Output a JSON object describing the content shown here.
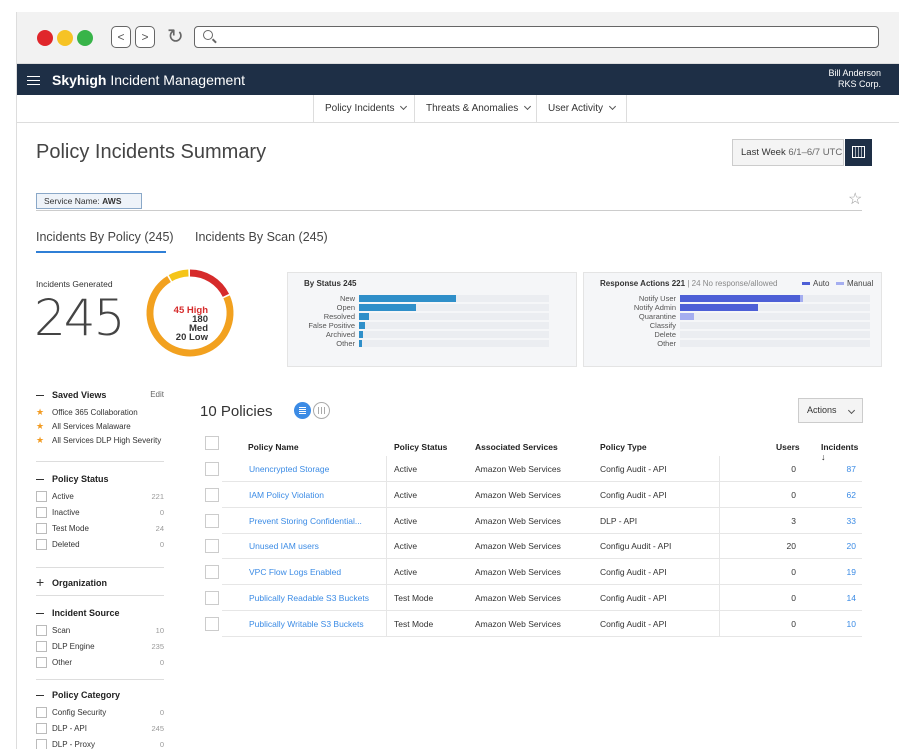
{
  "app": {
    "brand_bold": "Skyhigh",
    "brand_rest": "Incident Management",
    "user_name": "Bill Anderson",
    "user_org": "RKS Corp."
  },
  "browser": {
    "back_label": "<",
    "forward_label": ">",
    "reload_label": "↻",
    "traffic_lights": [
      "#e0262b",
      "#f6c325",
      "#38b449"
    ]
  },
  "topnav": {
    "items": [
      {
        "label": "Policy Incidents"
      },
      {
        "label": "Threats & Anomalies"
      },
      {
        "label": "User Activity"
      }
    ]
  },
  "page": {
    "title": "Policy Incidents Summary",
    "date_label": "Last Week",
    "date_range": "6/1–6/7 UTC",
    "filter_prefix": "Service Name:",
    "filter_value": "AWS",
    "tabs": [
      {
        "label": "Incidents By Policy (245)",
        "active": true
      },
      {
        "label": "Incidents By Scan (245)",
        "active": false
      }
    ]
  },
  "summary": {
    "generated_label": "Incidents Generated",
    "generated_value": "245",
    "severity": [
      {
        "count": "45",
        "label": "High",
        "color": "#d62b2b",
        "value": 45
      },
      {
        "count": "180",
        "label": "Med",
        "color": "#f2a11f",
        "value": 180
      },
      {
        "count": "20",
        "label": "Low",
        "color": "#f5c518",
        "value": 20
      }
    ]
  },
  "by_status": {
    "title_prefix": "By Status",
    "title_count": "245",
    "bars": [
      {
        "label": "New",
        "value": 97
      },
      {
        "label": "Open",
        "value": 57
      },
      {
        "label": "Resolved",
        "value": 10
      },
      {
        "label": "False Positive",
        "value": 6
      },
      {
        "label": "Archived",
        "value": 4
      },
      {
        "label": "Other",
        "value": 3
      }
    ],
    "max": 190,
    "color": "#2f8fc9"
  },
  "response_actions": {
    "title_prefix": "Response Actions",
    "title_count": "221",
    "subtitle": "| 24 No response/allowed",
    "legend": [
      {
        "label": "Auto",
        "color": "#4d5fd6"
      },
      {
        "label": "Manual",
        "color": "#a5aef0"
      }
    ],
    "bars": [
      {
        "label": "Notify User",
        "auto": 120,
        "manual": 3
      },
      {
        "label": "Notify Admin",
        "auto": 78,
        "manual": 0
      },
      {
        "label": "Quarantine",
        "auto": 0,
        "manual": 14
      },
      {
        "label": "Classify",
        "auto": 0,
        "manual": 0
      },
      {
        "label": "Delete",
        "auto": 0,
        "manual": 0
      },
      {
        "label": "Other",
        "auto": 0,
        "manual": 0
      }
    ],
    "max": 190
  },
  "sidebar": {
    "saved_views": {
      "title": "Saved Views",
      "edit_label": "Edit",
      "items": [
        {
          "label": "Office 365 Collaboration"
        },
        {
          "label": "All Services Malaware"
        },
        {
          "label": "All Services DLP High Severity"
        }
      ]
    },
    "policy_status": {
      "title": "Policy Status",
      "items": [
        {
          "label": "Active",
          "count": "221"
        },
        {
          "label": "Inactive",
          "count": "0"
        },
        {
          "label": "Test Mode",
          "count": "24"
        },
        {
          "label": "Deleted",
          "count": "0"
        }
      ]
    },
    "organization": {
      "title": "Organization"
    },
    "incident_source": {
      "title": "Incident Source",
      "items": [
        {
          "label": "Scan",
          "count": "10"
        },
        {
          "label": "DLP Engine",
          "count": "235"
        },
        {
          "label": "Other",
          "count": "0"
        }
      ]
    },
    "policy_category": {
      "title": "Policy Category",
      "items": [
        {
          "label": "Config Security",
          "count": "0"
        },
        {
          "label": "DLP - API",
          "count": "245"
        },
        {
          "label": "DLP - Proxy",
          "count": "0"
        }
      ]
    }
  },
  "table": {
    "title": "10 Policies",
    "actions_label": "Actions",
    "columns": {
      "name": "Policy Name",
      "status": "Policy Status",
      "services": "Associated Services",
      "type": "Policy Type",
      "users": "Users",
      "incidents": "Incidents",
      "sort_indicator": "↓"
    },
    "rows": [
      {
        "name": "Unencrypted Storage",
        "status": "Active",
        "services": "Amazon Web Services",
        "type": "Config Audit - API",
        "users": "0",
        "incidents": "87"
      },
      {
        "name": "IAM Policy Violation",
        "status": "Active",
        "services": "Amazon Web Services",
        "type": "Config Audit - API",
        "users": "0",
        "incidents": "62"
      },
      {
        "name": "Prevent Storing Confidential...",
        "status": "Active",
        "services": "Amazon Web Services",
        "type": "DLP - API",
        "users": "3",
        "incidents": "33"
      },
      {
        "name": "Unused IAM users",
        "status": "Active",
        "services": "Amazon Web Services",
        "type": "Configu Audit - API",
        "users": "20",
        "incidents": "20"
      },
      {
        "name": "VPC Flow Logs Enabled",
        "status": "Active",
        "services": "Amazon Web Services",
        "type": "Config Audit - API",
        "users": "0",
        "incidents": "19"
      },
      {
        "name": "Publically Readable S3 Buckets",
        "status": "Test Mode",
        "services": "Amazon Web Services",
        "type": "Config Audit - API",
        "users": "0",
        "incidents": "14"
      },
      {
        "name": "Publically Writable S3 Buckets",
        "status": "Test Mode",
        "services": "Amazon Web Services",
        "type": "Config Audit - API",
        "users": "0",
        "incidents": "10"
      }
    ]
  }
}
